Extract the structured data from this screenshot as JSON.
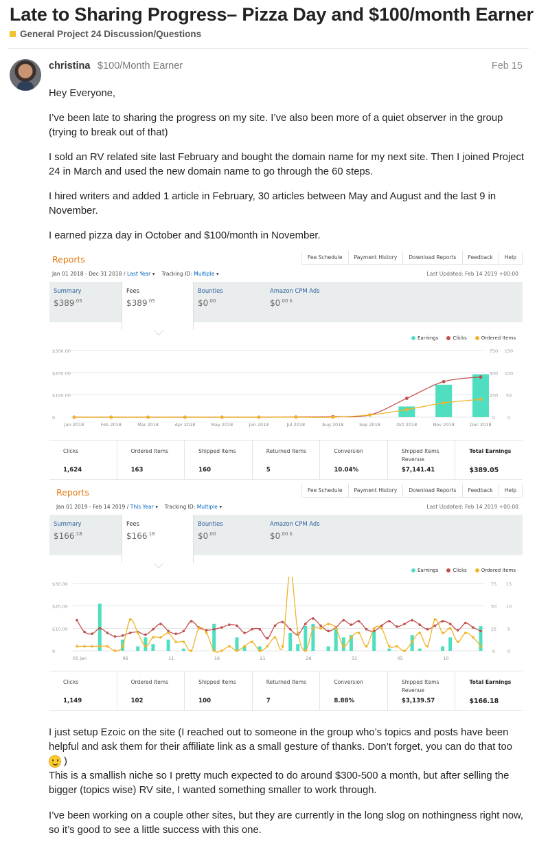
{
  "topic": {
    "title": "Late to Sharing Progress– Pizza Day and $100/month Earner",
    "category": "General Project 24 Discussion/Questions",
    "category_color": "#f1c232"
  },
  "post": {
    "username": "christina",
    "user_title": "$100/Month Earner",
    "date": "Feb 15",
    "p1": "Hey Everyone,",
    "p2": "I’ve been late to sharing the progress on my site. I’ve also been more of a quiet observer in the group (trying to break out of that)",
    "p3": "I sold an RV related site last February and bought the domain name for my next site. Then I joined Project 24 in March and used the new domain name to go through the 60 steps.",
    "p4": "I hired writers and added 1 article in February, 30 articles between May and August and the last 9 in November.",
    "p5": "I earned pizza day in October and $100/month in November.",
    "p6": "I just setup Ezoic on the site (I reached out to someone in the group who’s topics and posts have been helpful and ask them for their affiliate link as a small gesture of thanks. Don’t forget, you can do that too",
    "p6_end": ")",
    "p7": "This is a smallish niche so I pretty much expected to do around $300-500 a month, but after selling the bigger (topics wise) RV site, I wanted something smaller to work through.",
    "p8": "I’ve been working on a couple other sites, but they are currently in the long slog on nothingness right now, so it’s good to see a little success with this one."
  },
  "report_nav": [
    "Fee Schedule",
    "Payment History",
    "Download Reports",
    "Feedback",
    "Help"
  ],
  "legend": {
    "earnings": "Earnings",
    "clicks": "Clicks",
    "ordered": "Ordered Items"
  },
  "colors": {
    "earnings": "#4fdfc0",
    "clicks": "#c0504d",
    "ordered": "#f0b429",
    "link": "#0066c0",
    "reports": "#e47911"
  },
  "report1": {
    "title": "Reports",
    "date_range": "Jan 01 2018 - Dec 31 2018 /",
    "period": "Last Year",
    "tracking": "Tracking ID:",
    "tracking_val": "Multiple",
    "updated": "Last Updated: Feb 14 2019 +00:00",
    "tabs": [
      {
        "label": "Summary",
        "amt": "$389",
        "cents": ".05"
      },
      {
        "label": "Fees",
        "amt": "$389",
        "cents": ".05"
      },
      {
        "label": "Bounties",
        "amt": "$0",
        "cents": ".00"
      },
      {
        "label": "Amazon CPM Ads",
        "amt": "$0",
        "cents": ".00 $"
      }
    ],
    "stats": [
      {
        "label": "Clicks",
        "value": "1,624"
      },
      {
        "label": "Ordered Items",
        "value": "163"
      },
      {
        "label": "Shipped Items",
        "value": "160"
      },
      {
        "label": "Returned Items",
        "value": "5"
      },
      {
        "label": "Conversion",
        "value": "10.04%"
      },
      {
        "label": "Shipped Items Revenue",
        "value": "$7,141.41"
      },
      {
        "label": "Total Earnings",
        "value": "$389.05"
      }
    ]
  },
  "report2": {
    "title": "Reports",
    "date_range": "Jan 01 2019 - Feb 14 2019 /",
    "period": "This Year",
    "tracking": "Tracking ID:",
    "tracking_val": "Multiple",
    "updated": "Last Updated: Feb 14 2019 +00:00",
    "tabs": [
      {
        "label": "Summary",
        "amt": "$166",
        "cents": ".18"
      },
      {
        "label": "Fees",
        "amt": "$166",
        "cents": ".18"
      },
      {
        "label": "Bounties",
        "amt": "$0",
        "cents": ".00"
      },
      {
        "label": "Amazon CPM Ads",
        "amt": "$0",
        "cents": ".00 $"
      }
    ],
    "stats": [
      {
        "label": "Clicks",
        "value": "1,149"
      },
      {
        "label": "Ordered Items",
        "value": "102"
      },
      {
        "label": "Shipped Items",
        "value": "100"
      },
      {
        "label": "Returned Items",
        "value": "7"
      },
      {
        "label": "Conversion",
        "value": "8.88%"
      },
      {
        "label": "Shipped Items Revenue",
        "value": "$3,139.57"
      },
      {
        "label": "Total Earnings",
        "value": "$166.18"
      }
    ]
  },
  "chart_data": [
    {
      "type": "bar",
      "categories": [
        "Jan 2018",
        "Feb 2018",
        "Mar 2018",
        "Apr 2018",
        "May 2018",
        "Jun 2018",
        "Jul 2018",
        "Aug 2018",
        "Sep 2018",
        "Oct 2018",
        "Nov 2018",
        "Dec 2018"
      ],
      "y_left_ticks": [
        "$300.00",
        "$200.00",
        "$100.00",
        "0"
      ],
      "y_right_ticks": [
        [
          "750",
          "150"
        ],
        [
          "500",
          "100"
        ],
        [
          "250",
          "50"
        ],
        [
          "0",
          "0"
        ]
      ],
      "ylim": [
        0,
        300
      ],
      "series": [
        {
          "name": "Earnings",
          "type": "bar",
          "axis": "left",
          "values": [
            0,
            0,
            0,
            0,
            0,
            0,
            0,
            0,
            0,
            48,
            146,
            193
          ]
        },
        {
          "name": "Clicks",
          "type": "line",
          "axis": "right",
          "values": [
            0,
            0,
            0,
            0,
            0,
            0,
            2,
            6,
            25,
            212,
            400,
            452
          ]
        },
        {
          "name": "Ordered Items",
          "type": "line",
          "axis": "right",
          "values": [
            0,
            0,
            0,
            0,
            0,
            0,
            0,
            0,
            5,
            17,
            32,
            40
          ]
        }
      ]
    },
    {
      "type": "bar",
      "categories": [
        "01 Jan",
        "06",
        "11",
        "16",
        "21",
        "26",
        "31",
        "05",
        "10"
      ],
      "y_left_ticks": [
        "$30.00",
        "$20.00",
        "$10.00",
        "0"
      ],
      "y_right_ticks": [
        [
          "75",
          "15"
        ],
        [
          "50",
          "10"
        ],
        [
          "25",
          "5"
        ],
        [
          "0",
          "0"
        ]
      ],
      "ylim": [
        0,
        30
      ],
      "series": [
        {
          "name": "Earnings",
          "type": "bar",
          "axis": "left",
          "values": [
            0,
            0,
            0,
            21,
            0,
            0,
            5,
            0,
            2,
            6,
            3,
            0,
            5,
            0,
            1,
            0,
            0,
            0,
            12,
            0,
            0,
            6,
            2,
            0,
            2,
            0,
            0,
            0,
            8,
            3,
            11,
            12,
            0,
            2,
            10,
            6,
            7,
            0,
            0,
            9,
            0,
            1,
            0,
            0,
            7,
            1,
            0,
            0,
            2,
            6,
            0,
            0,
            0,
            11
          ]
        },
        {
          "name": "Clicks",
          "type": "line",
          "axis": "right",
          "values": [
            34,
            21,
            19,
            25,
            20,
            16,
            17,
            20,
            21,
            18,
            24,
            30,
            22,
            19,
            22,
            33,
            26,
            23,
            24,
            26,
            29,
            28,
            20,
            24,
            24,
            14,
            28,
            32,
            24,
            18,
            30,
            36,
            28,
            22,
            26,
            34,
            29,
            33,
            24,
            22,
            28,
            33,
            27,
            30,
            34,
            29,
            24,
            28,
            33,
            30,
            23,
            31,
            26,
            22
          ]
        },
        {
          "name": "Ordered Items",
          "type": "line",
          "axis": "right",
          "values": [
            1,
            1,
            1,
            1,
            1,
            0,
            1,
            7,
            4,
            1,
            3,
            3,
            4,
            2,
            2,
            0,
            5,
            4,
            0,
            0,
            1,
            0,
            1,
            2,
            0,
            1,
            3,
            1,
            18,
            4,
            0,
            5,
            5,
            6,
            5,
            1,
            3,
            4,
            1,
            5,
            5,
            1,
            1,
            0,
            2,
            4,
            1,
            7,
            4,
            5,
            2,
            4,
            3,
            1
          ]
        }
      ]
    }
  ]
}
